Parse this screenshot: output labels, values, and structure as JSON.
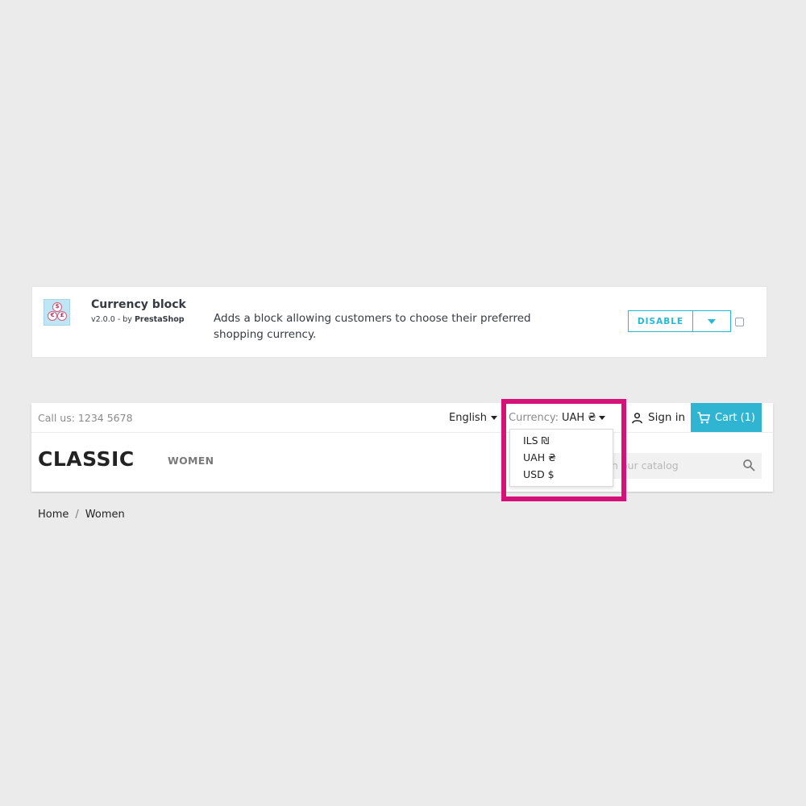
{
  "module": {
    "name": "Currency block",
    "version_prefix": "v2.0.0 - by ",
    "author": "PrestaShop",
    "description": "Adds a block allowing customers to choose their preferred shopping currency.",
    "disable_label": "DISABLE",
    "logo_coins": [
      "$",
      "€",
      "£"
    ]
  },
  "storefront": {
    "call_us": "Call us: 1234 5678",
    "language": "English",
    "currency_label": "Currency:",
    "currency_value": "UAH ₴",
    "sign_in": "Sign in",
    "cart": "Cart (1)",
    "logo": "CLASSIC",
    "nav": {
      "women": "WOMEN"
    },
    "search_placeholder": "Search our catalog",
    "search_visible_text": "h our catalog",
    "breadcrumb": {
      "home": "Home",
      "current": "Women"
    }
  },
  "currency_dropdown": {
    "options": [
      "ILS ₪",
      "UAH ₴",
      "USD $"
    ]
  },
  "colors": {
    "accent": "#25b9d7",
    "cart_bg": "#2fb5d2",
    "highlight": "#d41277",
    "page_bg": "#ebebec"
  }
}
